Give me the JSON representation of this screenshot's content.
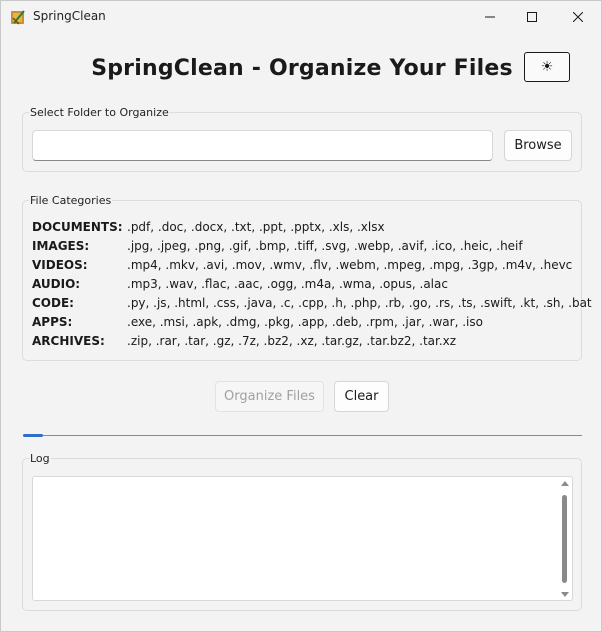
{
  "window": {
    "title": "SpringClean",
    "app_icon": "broom-icon",
    "controls": [
      "minimize-icon",
      "maximize-icon",
      "close-icon"
    ]
  },
  "header": {
    "title": "SpringClean - Organize Your Files",
    "theme_toggle_icon": "sun-icon",
    "theme_toggle_glyph": "☀"
  },
  "folder": {
    "group_label": "Select Folder to Organize",
    "value": "",
    "placeholder": "",
    "browse_label": "Browse"
  },
  "categories": {
    "group_label": "File Categories",
    "items": [
      {
        "name": "DOCUMENTS:",
        "extensions": ".pdf, .doc, .docx, .txt, .ppt, .pptx, .xls, .xlsx"
      },
      {
        "name": "IMAGES:",
        "extensions": ".jpg, .jpeg, .png, .gif, .bmp, .tiff, .svg, .webp, .avif, .ico, .heic, .heif"
      },
      {
        "name": "VIDEOS:",
        "extensions": ".mp4, .mkv, .avi, .mov, .wmv, .flv, .webm, .mpeg, .mpg, .3gp, .m4v, .hevc"
      },
      {
        "name": "AUDIO:",
        "extensions": ".mp3, .wav, .flac, .aac, .ogg, .m4a, .wma, .opus, .alac"
      },
      {
        "name": "CODE:",
        "extensions": ".py, .js, .html, .css, .java, .c, .cpp, .h, .php, .rb, .go, .rs, .ts, .swift, .kt, .sh, .bat"
      },
      {
        "name": "APPS:",
        "extensions": ".exe, .msi, .apk, .dmg, .pkg, .app, .deb, .rpm, .jar, .war, .iso"
      },
      {
        "name": "ARCHIVES:",
        "extensions": ".zip, .rar, .tar, .gz, .7z, .bz2, .xz, .tar.gz, .tar.bz2, .tar.xz"
      }
    ]
  },
  "actions": {
    "organize_label": "Organize Files",
    "organize_enabled": false,
    "clear_label": "Clear"
  },
  "progress": {
    "value_percent": 3.5,
    "color": "#2f6ec7"
  },
  "log": {
    "group_label": "Log",
    "content": ""
  }
}
